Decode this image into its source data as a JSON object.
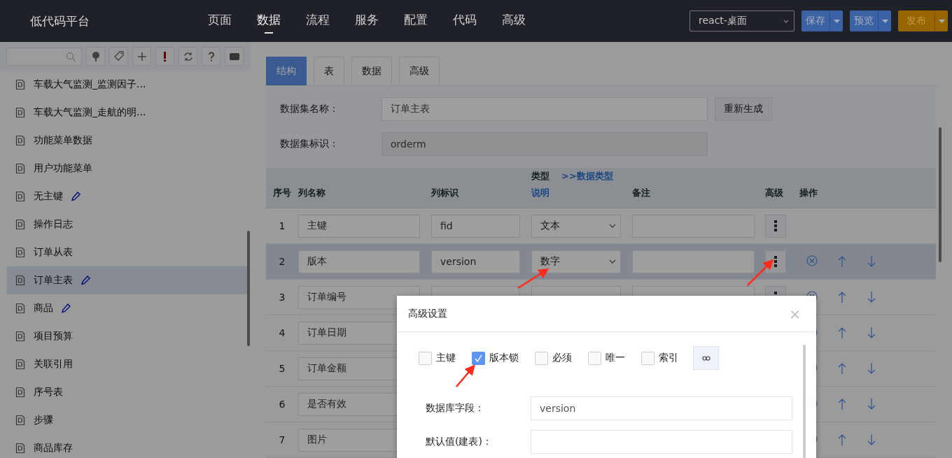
{
  "header": {
    "logo": "低代码平台",
    "nav": [
      {
        "label": "页面",
        "selected": false
      },
      {
        "label": "数据",
        "selected": true
      },
      {
        "label": "流程",
        "selected": false
      },
      {
        "label": "服务",
        "selected": false
      },
      {
        "label": "配置",
        "selected": false
      },
      {
        "label": "代码",
        "selected": false
      },
      {
        "label": "高级",
        "selected": false
      }
    ],
    "app_select": "react-桌面",
    "buttons": [
      {
        "label": "保存",
        "kind": "primary"
      },
      {
        "label": "预览",
        "kind": "primary"
      },
      {
        "label": "发布",
        "kind": "warning"
      }
    ]
  },
  "sidebar": {
    "items": [
      {
        "label": "车载大气监测_监测因子...",
        "selected": false,
        "editable": false
      },
      {
        "label": "车载大气监测_走航的明...",
        "selected": false,
        "editable": false
      },
      {
        "label": "功能菜单数据",
        "selected": false,
        "editable": false
      },
      {
        "label": "用户功能菜单",
        "selected": false,
        "editable": false
      },
      {
        "label": "无主键",
        "selected": false,
        "editable": true
      },
      {
        "label": "操作日志",
        "selected": false,
        "editable": false
      },
      {
        "label": "订单从表",
        "selected": false,
        "editable": false
      },
      {
        "label": "订单主表",
        "selected": true,
        "editable": true
      },
      {
        "label": "商品",
        "selected": false,
        "editable": true
      },
      {
        "label": "项目预算",
        "selected": false,
        "editable": false
      },
      {
        "label": "关联引用",
        "selected": false,
        "editable": false
      },
      {
        "label": "序号表",
        "selected": false,
        "editable": false
      },
      {
        "label": "步骤",
        "selected": false,
        "editable": false
      },
      {
        "label": "商品库存",
        "selected": false,
        "editable": false
      }
    ]
  },
  "tabs": [
    {
      "label": "结构",
      "selected": true
    },
    {
      "label": "表",
      "selected": false
    },
    {
      "label": "数据",
      "selected": false
    },
    {
      "label": "高级",
      "selected": false
    }
  ],
  "form": {
    "name_label": "数据集名称：",
    "name_value": "订单主表",
    "regenerate": "重新生成",
    "id_label": "数据集标识：",
    "id_value": "orderm"
  },
  "table": {
    "columns": {
      "index": "序号",
      "name": "列名称",
      "id": "列标识",
      "type": "类型",
      "type_note": "说明",
      "type_link": ">>数据类型",
      "note": "备注",
      "advanced": "高级",
      "actions": "操作"
    },
    "rows": [
      {
        "index": "1",
        "name": "主键",
        "id": "fid",
        "type": "文本",
        "actions": false,
        "selected": false
      },
      {
        "index": "2",
        "name": "版本",
        "id": "version",
        "type": "数字",
        "actions": true,
        "selected": true
      },
      {
        "index": "3",
        "name": "订单编号",
        "actions": true,
        "selected": false
      },
      {
        "index": "4",
        "name": "订单日期",
        "actions": true,
        "selected": false
      },
      {
        "index": "5",
        "name": "订单金额",
        "actions": true,
        "selected": false
      },
      {
        "index": "6",
        "name": "是否有效",
        "actions": true,
        "selected": false
      },
      {
        "index": "7",
        "name": "图片",
        "actions": true,
        "selected": false
      }
    ]
  },
  "modal": {
    "title": "高级设置",
    "close": "×",
    "checkboxes": [
      {
        "label": "主键",
        "checked": false
      },
      {
        "label": "版本锁",
        "checked": true
      },
      {
        "label": "必须",
        "checked": false
      },
      {
        "label": "唯一",
        "checked": false
      },
      {
        "label": "索引",
        "checked": false
      }
    ],
    "fields": [
      {
        "label": "数据库字段：",
        "value": "version"
      },
      {
        "label": "默认值(建表)："
      }
    ]
  },
  "annotations": [
    {
      "kind": "arrow"
    },
    {
      "kind": "arrow"
    },
    {
      "kind": "arrow"
    }
  ]
}
